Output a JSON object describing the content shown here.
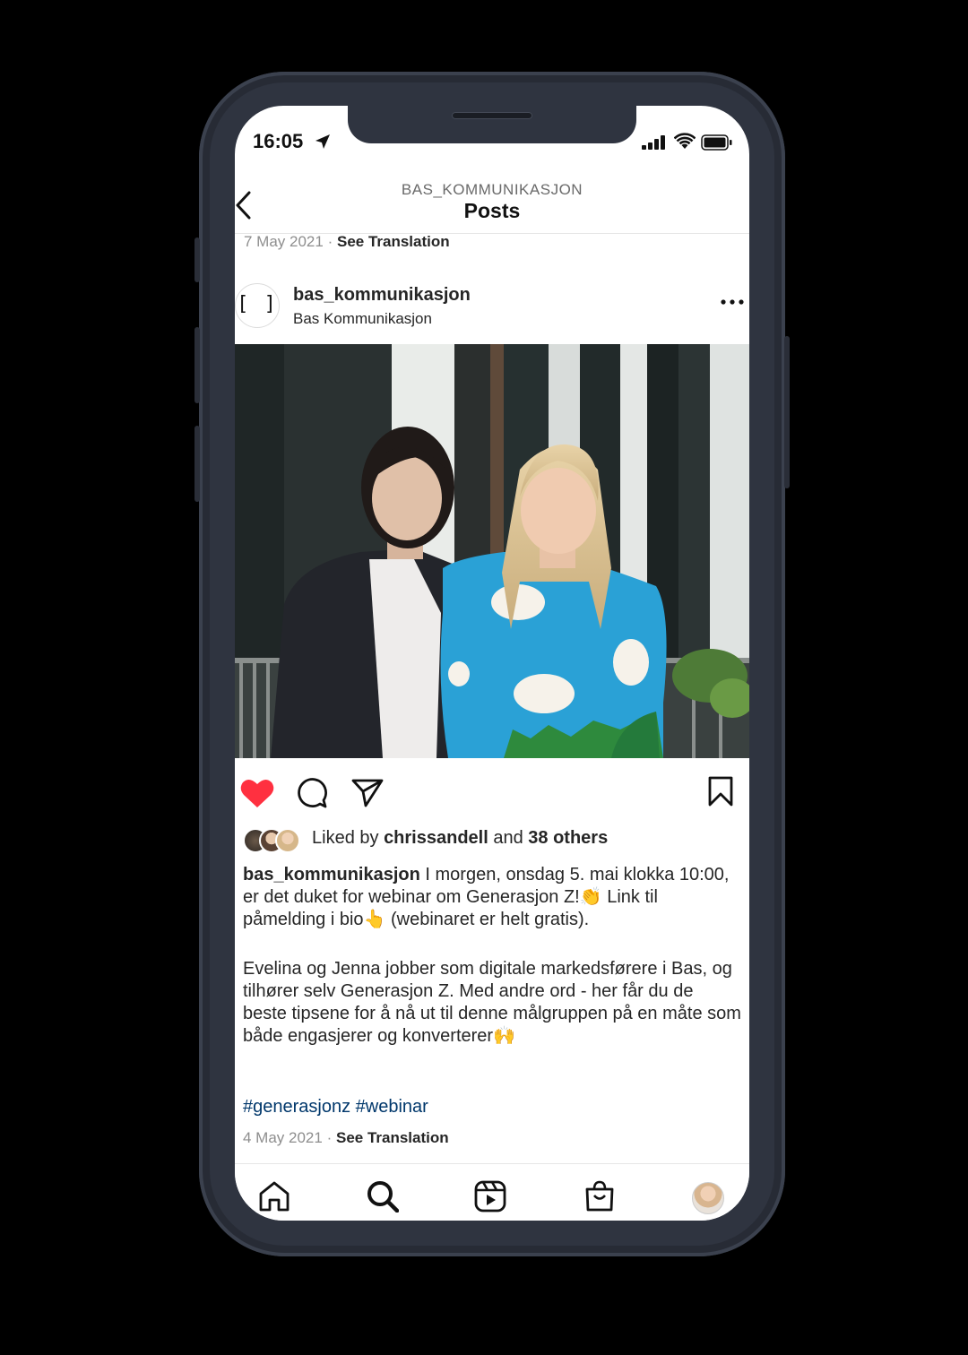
{
  "status_bar": {
    "time": "16:05"
  },
  "header": {
    "username": "BAS_KOMMUNIKASJON",
    "title": "Posts"
  },
  "previous_post": {
    "date": "7 May 2021",
    "separator": "·",
    "translation": "See Translation"
  },
  "post": {
    "username": "bas_kommunikasjon",
    "subtitle": "Bas Kommunikasjon",
    "avatar_text": "[ ]",
    "likes": {
      "prefix": "Liked by",
      "user": "chrissandell",
      "middle": "and",
      "others": "38 others"
    },
    "caption_user": "bas_kommunikasjon",
    "caption_line1": " I morgen, onsdag 5. mai klokka 10:00, er det duket for webinar om Generasjon Z!👏 Link til påmelding i bio👆 (webinaret er helt gratis).",
    "caption_para2": "Evelina og Jenna jobber som digitale markedsførere i Bas, og tilhører selv Generasjon Z. Med andre ord - her får du de beste tipsene for å nå ut til denne målgruppen på en måte som både engasjerer og konverterer🙌",
    "hashtags": "#generasjonz #webinar",
    "date": "4 May 2021",
    "separator": "·",
    "translation": "See Translation",
    "liked": true
  },
  "icons": {
    "like": "heart-icon",
    "comment": "comment-icon",
    "share": "send-icon",
    "save": "bookmark-icon",
    "tabs": [
      "home-icon",
      "search-icon",
      "reels-icon",
      "shop-icon",
      "profile-avatar"
    ]
  },
  "colors": {
    "like": "#ff3040",
    "hashtag": "#00376b",
    "meta": "#8e8e8e",
    "frame": "#2f3440"
  }
}
